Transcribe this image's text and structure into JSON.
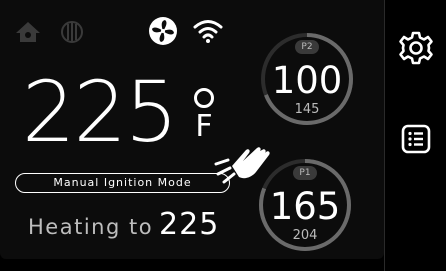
{
  "status_icons": [
    "home-icon",
    "grill-icon",
    "fan-icon",
    "wifi-icon"
  ],
  "grill": {
    "temperature": "225",
    "unit": "F",
    "mode": "Manual Ignition Mode",
    "heating_label": "Heating to",
    "heating_target": "225"
  },
  "probes": [
    {
      "label": "P2",
      "current": "100",
      "target": "145",
      "progress": 0.69
    },
    {
      "label": "P1",
      "current": "165",
      "target": "204",
      "progress": 0.81
    }
  ],
  "sidebar": {
    "icons": [
      "settings-gear-icon",
      "menu-list-icon"
    ]
  },
  "colors": {
    "background": "#0c0c0c",
    "ring": "#6a6a6a",
    "ring_track": "#2c2c2c",
    "text": "#ffffff"
  }
}
